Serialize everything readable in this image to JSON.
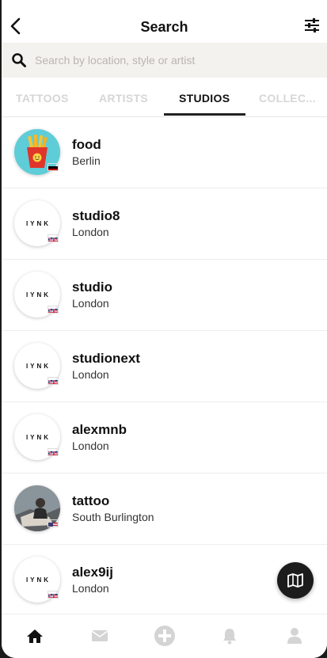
{
  "header": {
    "title": "Search",
    "back_icon": "chevron-left-icon",
    "filter_icon": "sliders-icon"
  },
  "search": {
    "placeholder": "Search by location, style or artist",
    "value": ""
  },
  "tabs": [
    {
      "label": "TATTOOS",
      "active": false
    },
    {
      "label": "ARTISTS",
      "active": false
    },
    {
      "label": "STUDIOS",
      "active": true
    },
    {
      "label": "COLLEC...",
      "active": false
    }
  ],
  "studios": [
    {
      "name": "food",
      "city": "Berlin",
      "avatar": "fries",
      "flag": "de"
    },
    {
      "name": "studio8",
      "city": "London",
      "avatar": "IYNK",
      "flag": "uk"
    },
    {
      "name": "studio",
      "city": "London",
      "avatar": "IYNK",
      "flag": "uk"
    },
    {
      "name": "studionext",
      "city": "London",
      "avatar": "IYNK",
      "flag": "uk"
    },
    {
      "name": "alexmnb",
      "city": "London",
      "avatar": "IYNK",
      "flag": "uk"
    },
    {
      "name": "tattoo",
      "city": "South Burlington",
      "avatar": "photo",
      "flag": "us"
    },
    {
      "name": "alex9ij",
      "city": "London",
      "avatar": "IYNK",
      "flag": "uk"
    }
  ],
  "map_button": {
    "icon": "map-icon"
  },
  "bottom_nav": [
    {
      "icon": "home-icon",
      "active": true
    },
    {
      "icon": "mail-icon",
      "active": false
    },
    {
      "icon": "add-icon",
      "active": false
    },
    {
      "icon": "bell-icon",
      "active": false
    },
    {
      "icon": "profile-icon",
      "active": false
    }
  ],
  "colors": {
    "active": "#111111",
    "inactive": "#d6d6d6",
    "search_bg": "#f4f2ee",
    "fab": "#1c1c1c"
  }
}
